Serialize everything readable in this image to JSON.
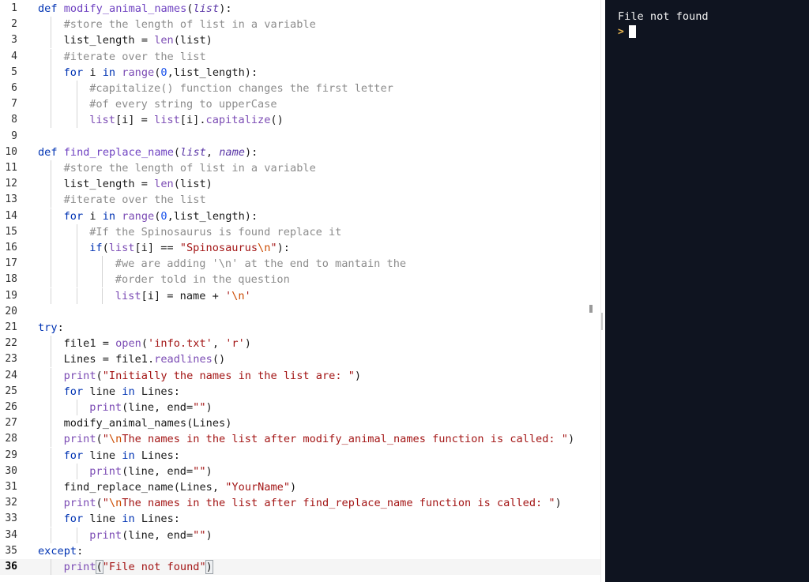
{
  "editor": {
    "current_line": 36,
    "lines": [
      [
        [
          "kw",
          "def "
        ],
        [
          "fn",
          "modify_animal_names"
        ],
        [
          "",
          "("
        ],
        [
          "par",
          "list"
        ],
        [
          "",
          "):"
        ]
      ],
      [
        [
          "cm",
          "#store the length of list in a variable"
        ]
      ],
      [
        [
          "",
          "list_length "
        ],
        [
          "",
          "= "
        ],
        [
          "bi",
          "len"
        ],
        [
          "",
          "(list)"
        ]
      ],
      [
        [
          "cm",
          "#iterate over the list"
        ]
      ],
      [
        [
          "kw",
          "for "
        ],
        [
          "",
          "i "
        ],
        [
          "kw",
          "in "
        ],
        [
          "bi",
          "range"
        ],
        [
          "",
          "("
        ],
        [
          "num",
          "0"
        ],
        [
          "",
          ",list_length):"
        ]
      ],
      [
        [
          "cm",
          "#capitalize() function changes the first letter"
        ]
      ],
      [
        [
          "cm",
          "#of every string to upperCase"
        ]
      ],
      [
        [
          "bi",
          "list"
        ],
        [
          "",
          "[i] = "
        ],
        [
          "bi",
          "list"
        ],
        [
          "",
          "[i]."
        ],
        [
          "bi",
          "capitalize"
        ],
        [
          "",
          "()"
        ]
      ],
      [],
      [
        [
          "kw",
          "def "
        ],
        [
          "fn",
          "find_replace_name"
        ],
        [
          "",
          "("
        ],
        [
          "par",
          "list"
        ],
        [
          "",
          ", "
        ],
        [
          "par",
          "name"
        ],
        [
          "",
          "):"
        ]
      ],
      [
        [
          "cm",
          "#store the length of list in a variable"
        ]
      ],
      [
        [
          "",
          "list_length = "
        ],
        [
          "bi",
          "len"
        ],
        [
          "",
          "(list)"
        ]
      ],
      [
        [
          "cm",
          "#iterate over the list"
        ]
      ],
      [
        [
          "kw",
          "for "
        ],
        [
          "",
          "i "
        ],
        [
          "kw",
          "in "
        ],
        [
          "bi",
          "range"
        ],
        [
          "",
          "("
        ],
        [
          "num",
          "0"
        ],
        [
          "",
          ",list_length):"
        ]
      ],
      [
        [
          "cm",
          "#If the Spinosaurus is found replace it"
        ]
      ],
      [
        [
          "kw",
          "if"
        ],
        [
          "",
          "("
        ],
        [
          "bi",
          "list"
        ],
        [
          "",
          "[i] == "
        ],
        [
          "st",
          "\"Spinosaurus"
        ],
        [
          "esc",
          "\\n"
        ],
        [
          "st",
          "\""
        ],
        [
          "",
          "):"
        ]
      ],
      [
        [
          "cm",
          "#we are adding '\\n' at the end to mantain the"
        ]
      ],
      [
        [
          "cm",
          "#order told in the question"
        ]
      ],
      [
        [
          "bi",
          "list"
        ],
        [
          "",
          "[i] = name + "
        ],
        [
          "st",
          "'"
        ],
        [
          "esc",
          "\\n"
        ],
        [
          "st",
          "'"
        ]
      ],
      [],
      [
        [
          "kw",
          "try"
        ],
        [
          "",
          ":"
        ]
      ],
      [
        [
          "",
          "file1 = "
        ],
        [
          "bi",
          "open"
        ],
        [
          "",
          "("
        ],
        [
          "st",
          "'info.txt'"
        ],
        [
          "",
          ", "
        ],
        [
          "st",
          "'r'"
        ],
        [
          "",
          ")"
        ]
      ],
      [
        [
          "",
          "Lines = file1."
        ],
        [
          "bi",
          "readlines"
        ],
        [
          "",
          "()"
        ]
      ],
      [
        [
          "bi",
          "print"
        ],
        [
          "",
          "("
        ],
        [
          "st",
          "\"Initially the names in the list are: \""
        ],
        [
          "",
          ")"
        ]
      ],
      [
        [
          "kw",
          "for "
        ],
        [
          "",
          "line "
        ],
        [
          "kw",
          "in "
        ],
        [
          "",
          "Lines:"
        ]
      ],
      [
        [
          "bi",
          "print"
        ],
        [
          "",
          "(line, end="
        ],
        [
          "st",
          "\"\""
        ],
        [
          "",
          ")"
        ]
      ],
      [
        [
          "",
          "modify_animal_names(Lines)"
        ]
      ],
      [
        [
          "bi",
          "print"
        ],
        [
          "",
          "("
        ],
        [
          "st",
          "\""
        ],
        [
          "esc",
          "\\n"
        ],
        [
          "st",
          "The names in the list after modify_animal_names function is called: \""
        ],
        [
          "",
          ")"
        ]
      ],
      [
        [
          "kw",
          "for "
        ],
        [
          "",
          "line "
        ],
        [
          "kw",
          "in "
        ],
        [
          "",
          "Lines:"
        ]
      ],
      [
        [
          "bi",
          "print"
        ],
        [
          "",
          "(line, end="
        ],
        [
          "st",
          "\"\""
        ],
        [
          "",
          ")"
        ]
      ],
      [
        [
          "",
          "find_replace_name(Lines, "
        ],
        [
          "st",
          "\"YourName\""
        ],
        [
          "",
          ")"
        ]
      ],
      [
        [
          "bi",
          "print"
        ],
        [
          "",
          "("
        ],
        [
          "st",
          "\""
        ],
        [
          "esc",
          "\\n"
        ],
        [
          "st",
          "The names in the list after find_replace_name function is called: \""
        ],
        [
          "",
          ")"
        ]
      ],
      [
        [
          "kw",
          "for "
        ],
        [
          "",
          "line "
        ],
        [
          "kw",
          "in "
        ],
        [
          "",
          "Lines:"
        ]
      ],
      [
        [
          "bi",
          "print"
        ],
        [
          "",
          "(line, end="
        ],
        [
          "st",
          "\"\""
        ],
        [
          "",
          ")"
        ]
      ],
      [
        [
          "kw",
          "except"
        ],
        [
          "",
          ":"
        ]
      ],
      [
        [
          "bi",
          "print"
        ],
        [
          "bm",
          "("
        ],
        [
          "st",
          "\"File not found\""
        ],
        [
          "bm",
          ")"
        ]
      ]
    ]
  },
  "console": {
    "output": "File not found",
    "prompt_symbol": ">"
  }
}
